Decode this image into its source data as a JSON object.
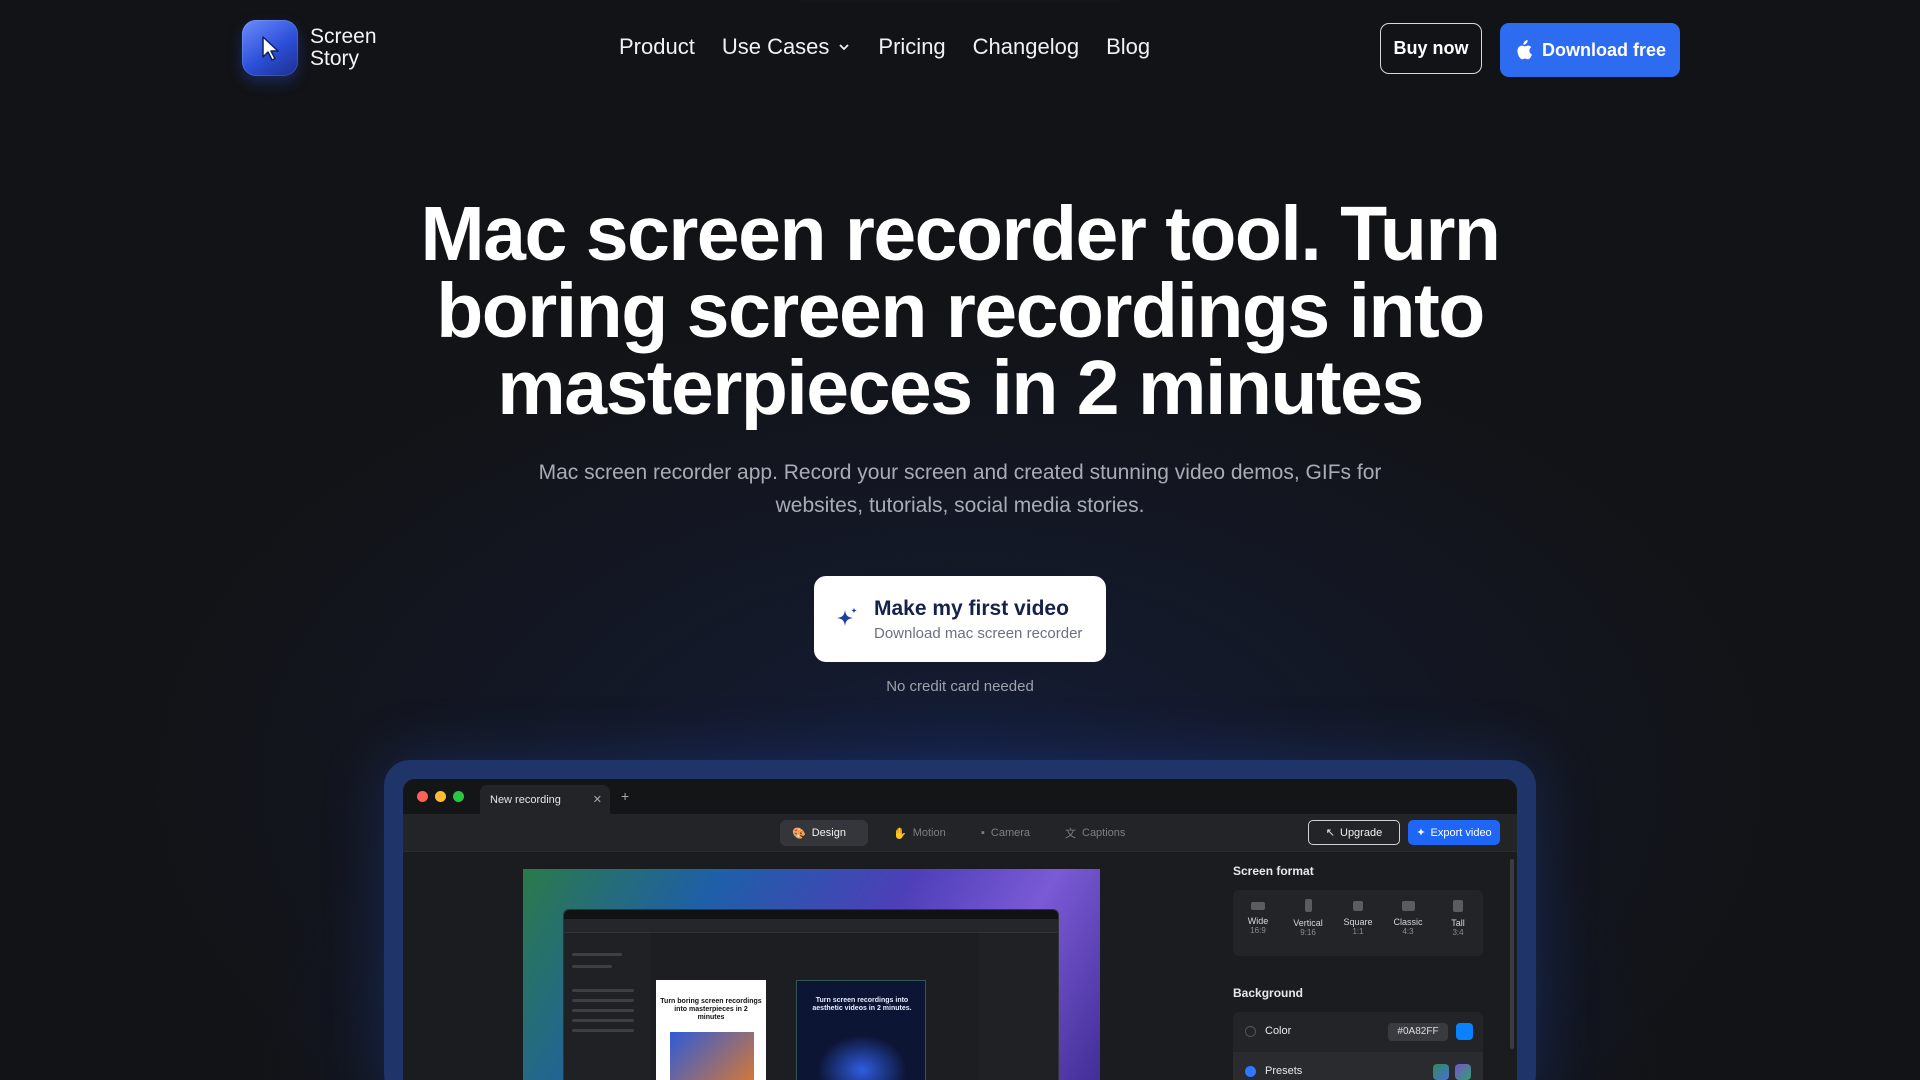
{
  "brand": {
    "name_line1": "Screen",
    "name_line2": "Story"
  },
  "nav": {
    "links": [
      "Product",
      "Use Cases",
      "Pricing",
      "Changelog",
      "Blog"
    ],
    "buy_label": "Buy now",
    "download_label": "Download free"
  },
  "hero": {
    "title": "Mac screen recorder tool. Turn boring screen recordings into masterpieces in 2 minutes",
    "subtitle": "Mac screen recorder app. Record your screen and created stunning video demos, GIFs for websites, tutorials, social media stories.",
    "cta_main": "Make my first video",
    "cta_sub": "Download mac screen recorder",
    "note": "No credit card needed"
  },
  "app": {
    "tab_title": "New recording",
    "modes": [
      "Design",
      "Motion",
      "Camera",
      "Captions"
    ],
    "active_mode": "Design",
    "upgrade_label": "Upgrade",
    "export_label": "Export video",
    "canvas_text_1": "Turn boring screen recordings into masterpieces in 2 minutes",
    "canvas_text_2": "Turn screen recordings into aesthetic videos in 2 minutes.",
    "screen_format_heading": "Screen format",
    "formats": [
      {
        "name": "Wide",
        "ratio": "16:9"
      },
      {
        "name": "Vertical",
        "ratio": "9:16"
      },
      {
        "name": "Square",
        "ratio": "1:1"
      },
      {
        "name": "Classic",
        "ratio": "4:3"
      },
      {
        "name": "Tall",
        "ratio": "3:4"
      }
    ],
    "background_heading": "Background",
    "color_label": "Color",
    "color_value": "#0A82FF",
    "presets_label": "Presets"
  },
  "colors": {
    "accent": "#2d6bf0",
    "swatch": "#0a82ff"
  }
}
